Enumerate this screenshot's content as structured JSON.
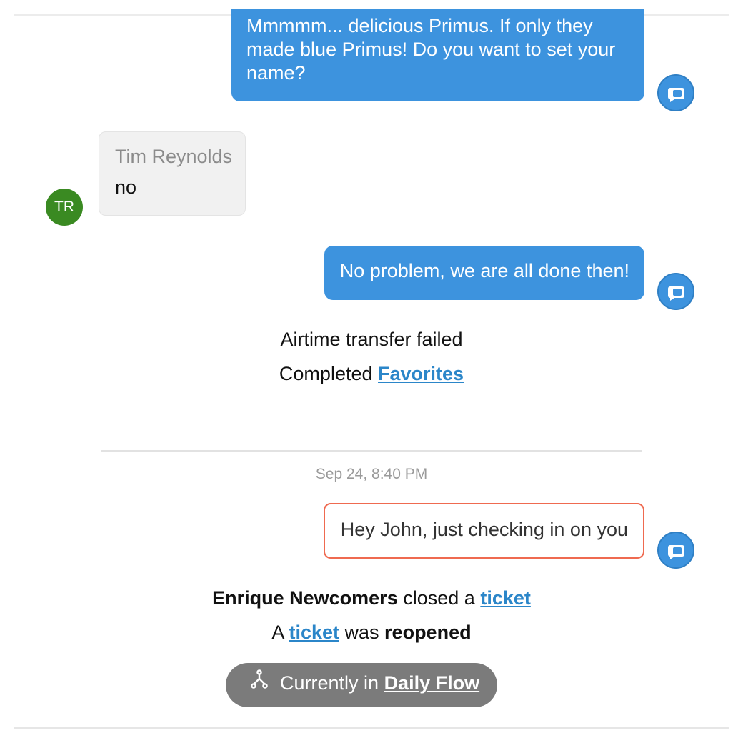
{
  "messages": {
    "outgoing_1": "Mmmmm... delicious Primus. If only they made blue Primus! Do you want to set your name?",
    "incoming": {
      "sender": "Tim Reynolds",
      "text": "no",
      "avatar_initials": "TR",
      "avatar_color": "#3a8a22"
    },
    "outgoing_2": "No problem, we are all done then!",
    "outgoing_3": "Hey John, just checking in on you"
  },
  "events": {
    "airtime": "Airtime transfer failed",
    "completed_prefix": "Completed",
    "completed_link": "Favorites",
    "closed_actor": "Enrique Newcomers",
    "closed_verb": "closed a",
    "closed_link": "ticket",
    "reopened_prefix": "A",
    "reopened_link": "ticket",
    "reopened_verb": "was",
    "reopened_state": "reopened"
  },
  "timestamp": "Sep 24, 8:40 PM",
  "flow": {
    "prefix": "Currently in",
    "name": "Daily Flow",
    "icon": "flow-split-icon"
  },
  "colors": {
    "outgoing": "#3d93de",
    "link": "#2b86c9",
    "outline": "#ef6a50",
    "pill": "#7b7b7b"
  }
}
